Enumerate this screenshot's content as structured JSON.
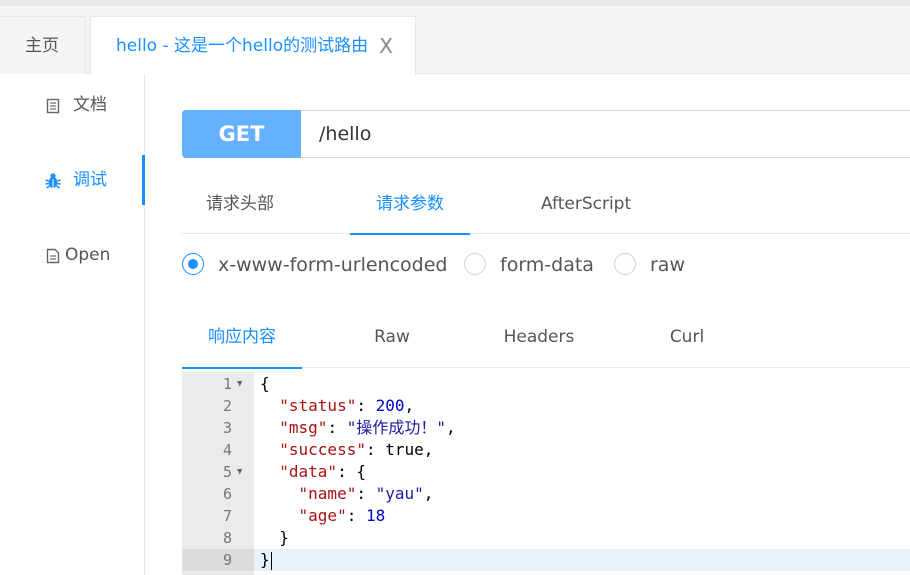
{
  "tabs": {
    "home_label": "主页",
    "active_label": "hello - 这是一个hello的测试路由",
    "close_glyph": "X"
  },
  "sidebar": {
    "items": [
      {
        "label": "文档",
        "icon": "document-icon"
      },
      {
        "label": "调试",
        "icon": "bug-icon"
      },
      {
        "label": "Open",
        "icon": "file-icon"
      }
    ]
  },
  "request": {
    "method": "GET",
    "url": "/hello",
    "tabs": [
      "请求头部",
      "请求参数",
      "AfterScript"
    ],
    "active_tab": "请求参数",
    "body_types": [
      "x-www-form-urlencoded",
      "form-data",
      "raw"
    ],
    "selected_body_type": "x-www-form-urlencoded"
  },
  "response": {
    "tabs": [
      "响应内容",
      "Raw",
      "Headers",
      "Curl"
    ],
    "active_tab": "响应内容",
    "lines": [
      {
        "num": "1",
        "text": "{"
      },
      {
        "num": "2",
        "text": "  \"status\": 200,"
      },
      {
        "num": "3",
        "text": "  \"msg\": \"操作成功！\","
      },
      {
        "num": "4",
        "text": "  \"success\": true,"
      },
      {
        "num": "5",
        "text": "  \"data\": {"
      },
      {
        "num": "6",
        "text": "    \"name\": \"yau\","
      },
      {
        "num": "7",
        "text": "    \"age\": 18"
      },
      {
        "num": "8",
        "text": "  }"
      },
      {
        "num": "9",
        "text": "}"
      }
    ]
  },
  "colors": {
    "accent": "#1890ff",
    "method_bg": "#66b1ff"
  }
}
